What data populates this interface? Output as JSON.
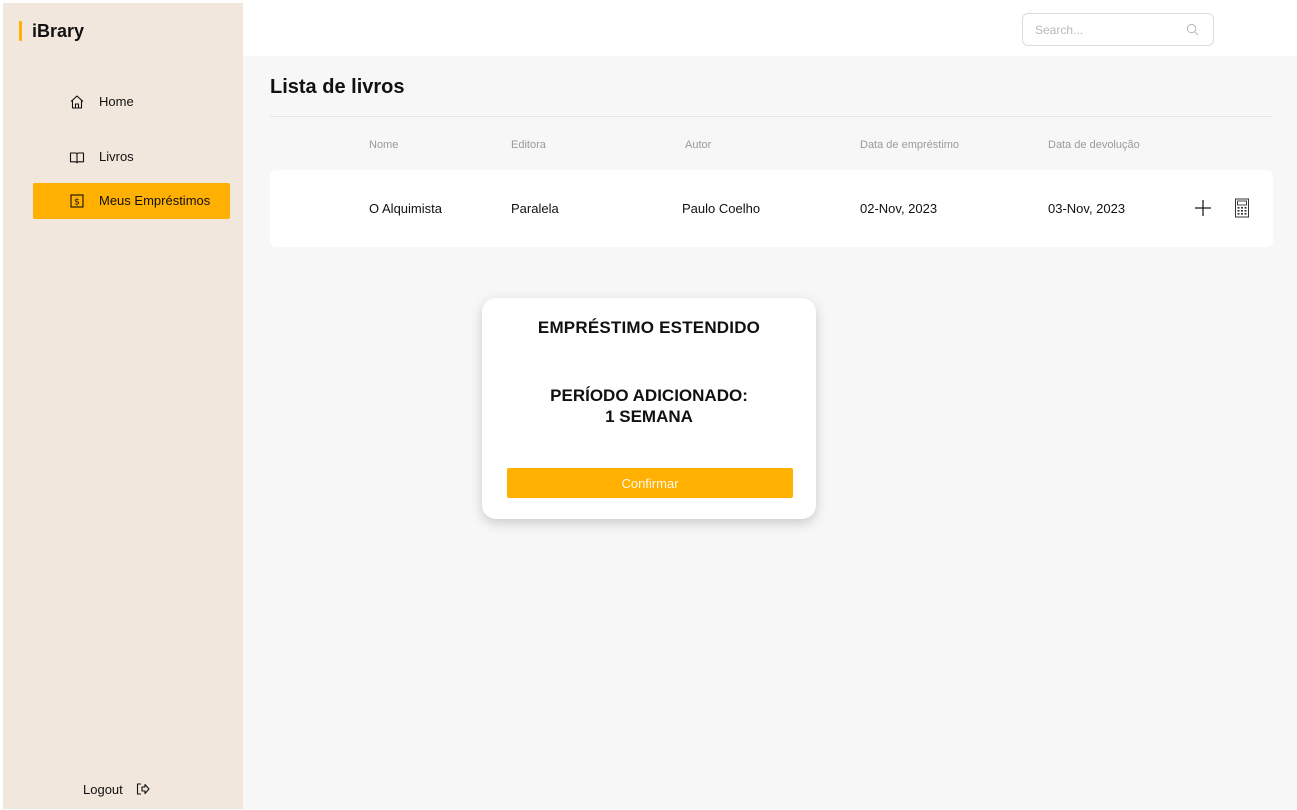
{
  "app": {
    "brand": "iBrary"
  },
  "sidebar": {
    "items": [
      {
        "label": "Home",
        "icon": "home-icon"
      },
      {
        "label": "Livros",
        "icon": "book-icon"
      },
      {
        "label": "Meus Empréstimos",
        "icon": "dollar-icon",
        "active": true
      }
    ],
    "logout_label": "Logout"
  },
  "search": {
    "placeholder": "Search..."
  },
  "main": {
    "title": "Lista de livros",
    "columns": [
      "Nome",
      "Editora",
      "Autor",
      "Data de empréstimo",
      "Data de devolução"
    ],
    "rows": [
      {
        "nome": "O Alquimista",
        "editora": "Paralela",
        "autor": "Paulo Coelho",
        "data_emprestimo": "02-Nov, 2023",
        "data_devolucao": "03-Nov, 2023"
      }
    ]
  },
  "modal": {
    "title": "EMPRÉSTIMO ESTENDIDO",
    "line1": "PERÍODO ADICIONADO:",
    "line2": "1 SEMANA",
    "confirm_label": "Confirmar"
  },
  "colors": {
    "accent": "#ffb000",
    "sidebar_bg": "#f2e7dd",
    "main_bg": "#f7f7f7"
  }
}
